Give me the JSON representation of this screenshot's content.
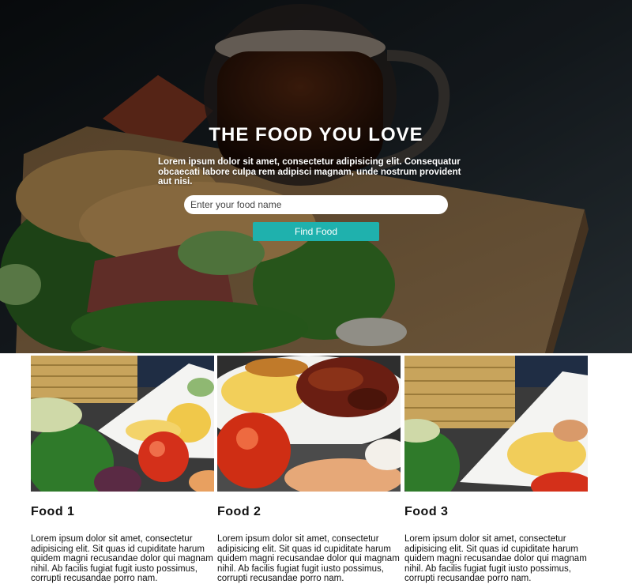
{
  "hero": {
    "title": "THE FOOD YOU LOVE",
    "text": "Lorem ipsum dolor sit amet, consectetur adipisicing elit. Consequatur obcaecati labore culpa rem adipisci magnam, unde nostrum provident aut nisi.",
    "search_placeholder": "Enter your food name",
    "button_label": "Find Food"
  },
  "cards": [
    {
      "title": "Food 1",
      "text": "Lorem ipsum dolor sit amet, consectetur adipisicing elit. Sit quas id cupiditate harum quidem magni recusandae dolor qui magnam nihil. Ab facilis fugiat fugit iusto possimus, corrupti recusandae porro nam."
    },
    {
      "title": "Food 2",
      "text": "Lorem ipsum dolor sit amet, consectetur adipisicing elit. Sit quas id cupiditate harum quidem magni recusandae dolor qui magnam nihil. Ab facilis fugiat fugit iusto possimus, corrupti recusandae porro nam."
    },
    {
      "title": "Food 3",
      "text": "Lorem ipsum dolor sit amet, consectetur adipisicing elit. Sit quas id cupiditate harum quidem magni recusandae dolor qui magnam nihil. Ab facilis fugiat fugit iusto possimus, corrupti recusandae porro nam."
    }
  ],
  "colors": {
    "accent": "#1fb1ad",
    "hero_overlay": "#000000",
    "text_dark": "#111111"
  }
}
